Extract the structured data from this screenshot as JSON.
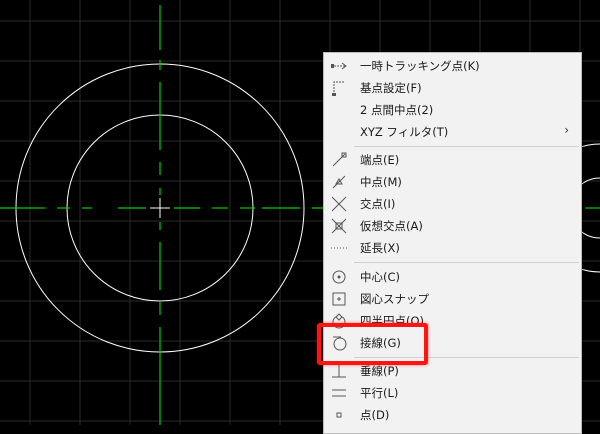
{
  "colors": {
    "background": "#000000",
    "crosshair": "#00cc00",
    "circle": "#ffffff",
    "highlight": "#ff1414"
  },
  "menu": {
    "items": [
      {
        "label": "一時トラッキング点(K)",
        "icon": "temporary-tracking-icon"
      },
      {
        "label": "基点設定(F)",
        "icon": "from-point-icon"
      },
      {
        "label": "2 点間中点(2)",
        "icon": ""
      },
      {
        "label": "XYZ フィルタ(T)",
        "icon": "",
        "submenu": "›"
      },
      {
        "label": "端点(E)",
        "icon": "endpoint-icon"
      },
      {
        "label": "中点(M)",
        "icon": "midpoint-icon"
      },
      {
        "label": "交点(I)",
        "icon": "intersection-icon"
      },
      {
        "label": "仮想交点(A)",
        "icon": "apparent-intersection-icon"
      },
      {
        "label": "延長(X)",
        "icon": "extension-icon"
      },
      {
        "label": "中心(C)",
        "icon": "center-icon"
      },
      {
        "label": "図心スナップ",
        "icon": "centroid-icon"
      },
      {
        "label": "四半円点(Q)",
        "icon": "quadrant-icon"
      },
      {
        "label": "接線(G)",
        "icon": "tangent-icon"
      },
      {
        "label": "垂線(P)",
        "icon": "perpendicular-icon"
      },
      {
        "label": "平行(L)",
        "icon": "parallel-icon"
      },
      {
        "label": "点(D)",
        "icon": "node-icon"
      }
    ]
  }
}
